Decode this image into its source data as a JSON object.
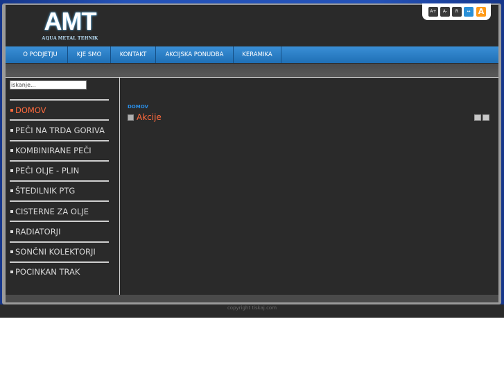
{
  "logo": {
    "main": "AMT",
    "sub": "AQUA METAL TEHNIK"
  },
  "font_tools": [
    {
      "label": "A+",
      "icon": "font-increase-icon"
    },
    {
      "label": "A-",
      "icon": "font-decrease-icon"
    },
    {
      "label": "R",
      "icon": "font-reset-icon"
    },
    {
      "label": "↔",
      "icon": "width-toggle-icon"
    },
    {
      "label": "A",
      "icon": "accessibility-icon"
    }
  ],
  "nav": {
    "items": [
      "O PODJETJU",
      "KJE SMO",
      "KONTAKT",
      "AKCIJSKA PONUDBA",
      "KERAMIKA"
    ]
  },
  "search": {
    "placeholder": "iskanje..."
  },
  "sidebar": {
    "items": [
      {
        "label": "DOMOV",
        "active": true
      },
      {
        "label": "PEČI NA TRDA GORIVA"
      },
      {
        "label": "KOMBINIRANE PEČI"
      },
      {
        "label": "PEČI OLJE - PLIN"
      },
      {
        "label": "ŠTEDILNIK PTG"
      },
      {
        "label": "CISTERNE ZA OLJE"
      },
      {
        "label": "RADIATORJI"
      },
      {
        "label": "SONČNI KOLEKTORJI"
      },
      {
        "label": "POCINKAN TRAK"
      }
    ]
  },
  "main": {
    "breadcrumb": "DOMOV",
    "article": {
      "title": "Akcije"
    }
  },
  "footer": {
    "copyright": "copyright tiskaj.com"
  },
  "colors": {
    "accent": "#ff6a3d",
    "nav_blue": "#1f6fb5",
    "link_blue": "#2a8ee6",
    "panel_dark": "#2a2a2a",
    "frame_gray": "#9a9a9a",
    "tool_orange": "#ff9a18"
  }
}
